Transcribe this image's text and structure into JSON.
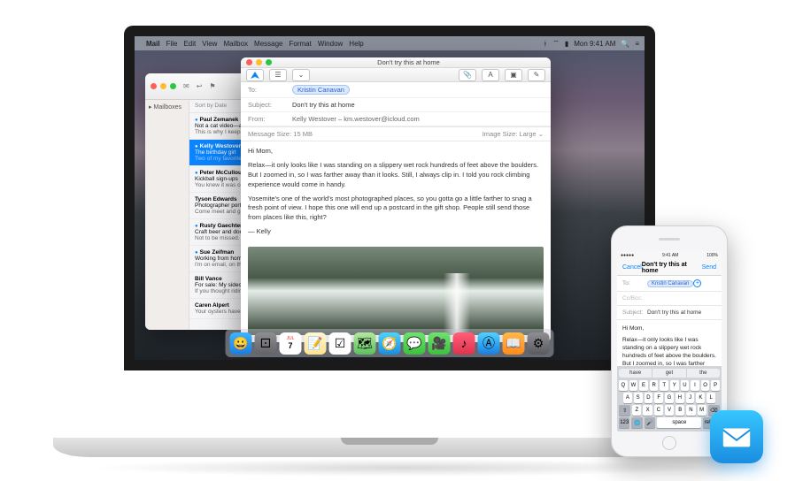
{
  "menubar": {
    "app": "Mail",
    "items": [
      "File",
      "Edit",
      "View",
      "Mailbox",
      "Message",
      "Format",
      "Window",
      "Help"
    ],
    "time": "Mon 9:41 AM"
  },
  "mailbox": {
    "sidebar_label": "Mailboxes",
    "sort": "Sort by Date",
    "messages": [
      {
        "from": "Paul Zemanek",
        "subject": "Not a cat video—a m…",
        "preview": "This is why I keep my… park. Astro, a shephe…",
        "unread": true
      },
      {
        "from": "Kelly Westover",
        "subject": "The birthday girl",
        "preview": "Two of my favorite fo… celebrate with you. H…",
        "unread": true,
        "selected": true
      },
      {
        "from": "Peter McCullough",
        "subject": "Kickball sign-ups",
        "preview": "You knew it was comin… players, rookie player…",
        "unread": true
      },
      {
        "from": "Tyson Edwards",
        "subject": "Photographer portfolio",
        "preview": "Come meet and greet… great shooters. There…"
      },
      {
        "from": "Rusty Gaechter",
        "subject": "Craft beer and doom r…",
        "preview": "Not to be missed. A c… each sample is paired…",
        "unread": true
      },
      {
        "from": "Sue Zeifman",
        "subject": "Working from home",
        "preview": "I'm on email, on the p… work, but I'm not 'the…",
        "unread": true
      },
      {
        "from": "Bill Vance",
        "subject": "For sale: My sidecar m…",
        "preview": "If you thought riding… try this. And you can t…"
      },
      {
        "from": "Caren Alpert",
        "subject": "",
        "preview": "Your oysters have arriv…"
      }
    ]
  },
  "compose": {
    "title": "Don't try this at home",
    "to_label": "To:",
    "to_value": "Kristin Canavan",
    "subject_label": "Subject:",
    "subject_value": "Don't try this at home",
    "from_label": "From:",
    "from_value": "Kelly Westover – km.westover@icloud.com",
    "msg_size_label": "Message Size:",
    "msg_size_value": "15 MB",
    "img_size_label": "Image Size:",
    "img_size_value": "Large",
    "body_greeting": "Hi Mom,",
    "body_p1": "Relax—it only looks like I was standing on a slippery wet rock hundreds of feet above the boulders. But I zoomed in, so I was farther away than it looks. Still, I always clip in. I told you rock climbing experience would come in handy.",
    "body_p2": "Yosemite's one of the world's most photographed places, so you gotta go a little farther to snag a fresh point of view. I hope this one will end up a postcard in the gift shop. People still send those from places like this, right?",
    "body_sig": "— Kelly"
  },
  "iphone": {
    "carrier": "●●●●●",
    "time": "9:41 AM",
    "battery": "100%",
    "cancel": "Cancel",
    "title": "Don't try this at home",
    "send": "Send",
    "to_label": "To:",
    "to_value": "Kristin Canavan",
    "ccbcc": "Cc/Bcc:",
    "subject_label": "Subject:",
    "subject_value": "Don't try this at home",
    "body_greeting": "Hi Mom,",
    "body_p1": "Relax—it only looks like I was standing on a slippery wet rock hundreds of feet above the boulders. But I zoomed in, so I was farther away than it looks. Still, I always",
    "suggestions": [
      "have",
      "get",
      "the"
    ],
    "rows": [
      [
        "Q",
        "W",
        "E",
        "R",
        "T",
        "Y",
        "U",
        "I",
        "O",
        "P"
      ],
      [
        "A",
        "S",
        "D",
        "F",
        "G",
        "H",
        "J",
        "K",
        "L"
      ],
      [
        "Z",
        "X",
        "C",
        "V",
        "B",
        "N",
        "M"
      ]
    ],
    "num_key": "123",
    "space": "space",
    "return": "return"
  },
  "dock": {
    "cal_month": "JUL",
    "cal_day": "7"
  }
}
